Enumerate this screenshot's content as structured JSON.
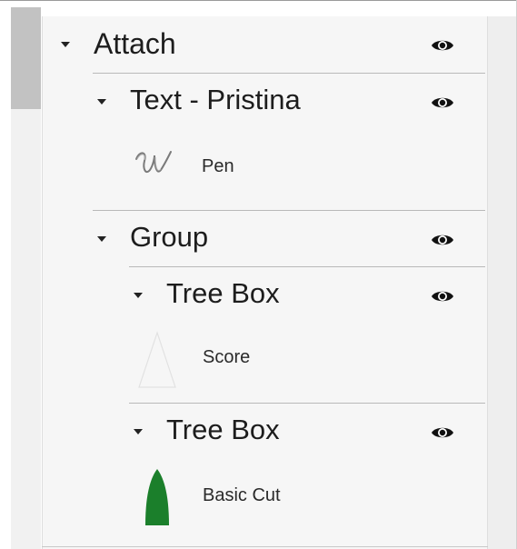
{
  "layers": {
    "attach": {
      "label": "Attach",
      "visibility_icon": "eye-icon",
      "text_layer": {
        "label": "Text - Pristina",
        "visibility_icon": "eye-icon",
        "operation": {
          "label": "Pen",
          "icon": "script-w-icon"
        }
      },
      "group": {
        "label": "Group",
        "visibility_icon": "eye-icon",
        "tree_box_1": {
          "label": "Tree Box",
          "visibility_icon": "eye-icon",
          "operation": {
            "label": "Score",
            "icon": "tree-outline-icon"
          }
        },
        "tree_box_2": {
          "label": "Tree Box",
          "visibility_icon": "eye-icon",
          "operation": {
            "label": "Basic Cut",
            "icon": "tree-filled-icon"
          }
        }
      }
    }
  },
  "colors": {
    "panel_background": "#f6f6f6",
    "divider": "#b9b9b9",
    "text": "#1d1d1d",
    "scroll_thumb": "#c2c2c2",
    "basic_cut_fill": "#1b7f2b"
  }
}
